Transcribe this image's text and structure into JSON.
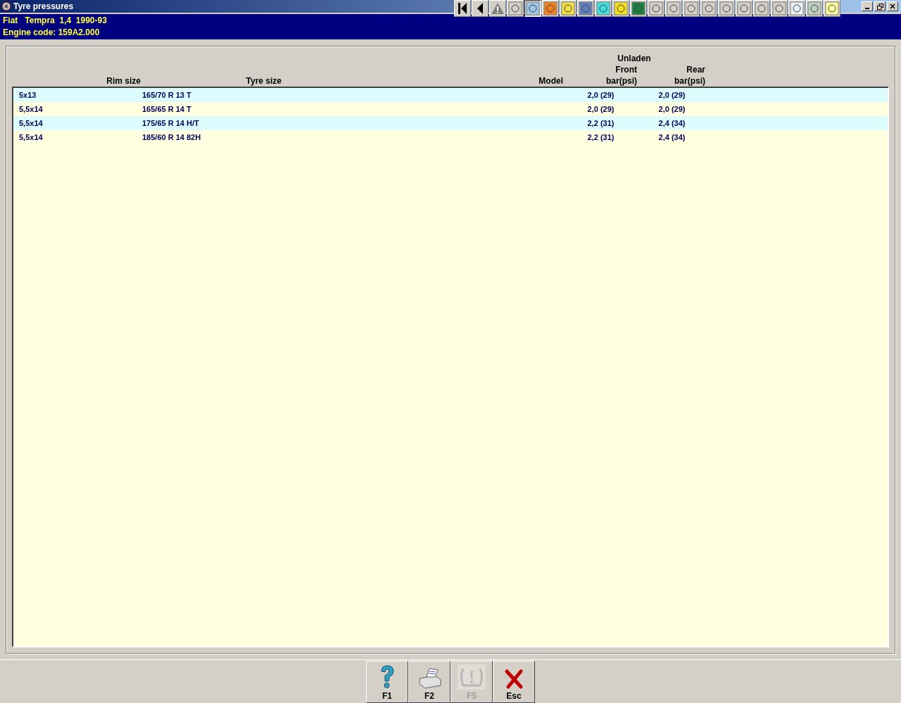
{
  "window": {
    "title": "Tyre pressures"
  },
  "toolbar": [
    {
      "selected": false
    },
    {
      "selected": false
    },
    {
      "selected": false
    },
    {
      "selected": false
    },
    {
      "selected": true
    },
    {
      "selected": false
    },
    {
      "selected": false
    },
    {
      "selected": false
    },
    {
      "selected": false
    },
    {
      "selected": false
    },
    {
      "selected": false
    },
    {
      "selected": false
    },
    {
      "selected": false
    },
    {
      "selected": false
    },
    {
      "selected": false
    },
    {
      "selected": false
    },
    {
      "selected": false
    },
    {
      "selected": false
    },
    {
      "selected": false
    },
    {
      "selected": false
    },
    {
      "selected": false
    },
    {
      "selected": false
    }
  ],
  "vehicle": {
    "model_line": "Fiat   Tempra  1,4  1990-93",
    "engine_line": "Engine code: 159A2.000"
  },
  "table": {
    "group_heading": "Unladen",
    "columns": [
      {
        "label": "Rim size"
      },
      {
        "label": "Tyre size"
      },
      {
        "label": "Model"
      },
      {
        "label": "Front",
        "unit": "bar(psi)"
      },
      {
        "label": "Rear",
        "unit": "bar(psi)"
      }
    ],
    "rows": [
      {
        "rim": "5x13",
        "tyre": "165/70 R 13 T",
        "front": "2,0 (29)",
        "rear": "2,0 (29)"
      },
      {
        "rim": "5,5x14",
        "tyre": "165/65 R 14 T",
        "front": "2,0 (29)",
        "rear": "2,0 (29)"
      },
      {
        "rim": "5,5x14",
        "tyre": "175/65 R 14 H/T",
        "front": "2,2 (31)",
        "rear": "2,4 (34)"
      },
      {
        "rim": "5,5x14",
        "tyre": "185/60 R 14 82H",
        "front": "2,2 (31)",
        "rear": "2,4 (34)"
      }
    ]
  },
  "buttons": [
    {
      "kind": "help",
      "label": "F1",
      "disabled": false
    },
    {
      "kind": "print",
      "label": "F2",
      "disabled": false
    },
    {
      "kind": "tyre",
      "label": "F5",
      "disabled": true
    },
    {
      "kind": "close",
      "label": "Esc",
      "disabled": false
    }
  ]
}
